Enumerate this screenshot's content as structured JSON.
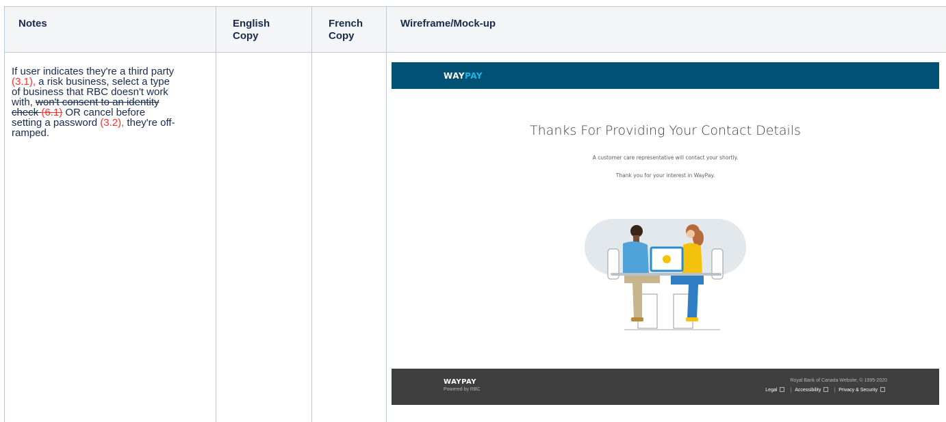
{
  "table": {
    "headers": {
      "notes": "Notes",
      "english_line1": "English",
      "english_line2": "Copy",
      "french_line1": "French",
      "french_line2": "Copy",
      "wireframe": "Wireframe/Mock-up"
    },
    "note_lines": [
      {
        "segments": [
          {
            "text": "If user indicates they're a third party",
            "style": "normal"
          }
        ]
      },
      {
        "segments": [
          {
            "text": "(3.1),",
            "style": "red"
          },
          {
            "text": " a risk business, select a type",
            "style": "normal"
          }
        ]
      },
      {
        "segments": [
          {
            "text": "of business that RBC doesn't work",
            "style": "normal"
          }
        ]
      },
      {
        "segments": [
          {
            "text": "with, ",
            "style": "normal"
          },
          {
            "text": "won't consent to an identity",
            "style": "strike"
          }
        ]
      },
      {
        "segments": [
          {
            "text": "check ",
            "style": "strike"
          },
          {
            "text": "(6.1)",
            "style": "red-strike"
          },
          {
            "text": " OR cancel before",
            "style": "normal"
          }
        ]
      },
      {
        "segments": [
          {
            "text": "setting a password ",
            "style": "normal"
          },
          {
            "text": "(3.2),",
            "style": "red"
          },
          {
            "text": " they're off-",
            "style": "normal"
          }
        ]
      },
      {
        "segments": [
          {
            "text": "ramped.",
            "style": "normal"
          }
        ]
      }
    ]
  },
  "mockup": {
    "header_logo_way": "WAY",
    "header_logo_pay": "PAY",
    "title": "Thanks For Providing Your Contact Details",
    "line1": "A customer care representative will contact your shortly.",
    "line2": "Thank you for your interest in WayPay.",
    "footer": {
      "logo": "WAYPAY",
      "powered": "Powered by RBC",
      "copyright": "Royal Bank of Canada Website, © 1995-2020",
      "links": [
        "Legal",
        "Accessibility",
        "Privacy & Security"
      ],
      "separator": "|"
    },
    "colors": {
      "header_bg": "#005174",
      "logo_accent": "#25b3e4",
      "footer_bg": "#3f3f3f",
      "note_red": "#ff2d2d"
    }
  }
}
